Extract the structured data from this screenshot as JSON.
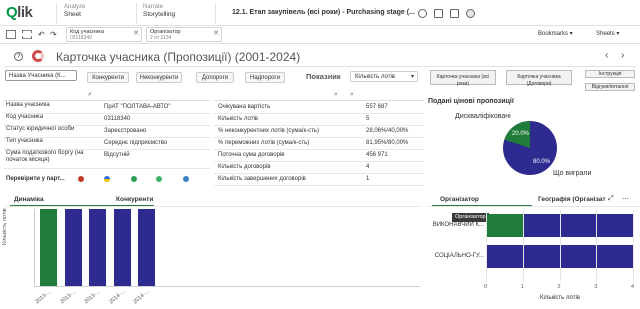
{
  "topbar": {
    "logo_prefix": "Q",
    "logo_suffix": "lik",
    "analyze_label": "Analyze",
    "analyze_value": "Sheet",
    "narrate_label": "Narrate",
    "narrate_value": "Storytelling",
    "app_title": "12.1. Етап закупівель (всі роки) - Purchasing stage (...",
    "bookmarks": "Bookmarks",
    "sheets": "Sheets"
  },
  "filters": [
    {
      "field": "Код учасника",
      "value": "03118340"
    },
    {
      "field": "Організатор",
      "value": "2 от 1134"
    }
  ],
  "sheet": {
    "title": "Карточка учасника (Пропозиції) (2001-2024)"
  },
  "controls": {
    "participant_name_btn": "Назва Учасника (К...",
    "competitors_btn": "Конкуренти",
    "noncompetitors_btn": "Неконкуренти",
    "suppliers_btn": "Допороги",
    "overthreshold_btn": "Надпороги",
    "indicator_label": "Показник",
    "indicator_value": "Кількість лотів",
    "card_all": "Карточка учасника (всі роки)",
    "card_contracts": "Карточка учасника (Договори)",
    "instruction": "Інструкція",
    "feedback": "Відгуки/питання"
  },
  "left_table": [
    {
      "label": "Назва учасника",
      "value": "ПрАТ \"ПОЛТАВА-АВТО\""
    },
    {
      "label": "Код учасника",
      "value": "03118340"
    },
    {
      "label": "Статус юридичної особи",
      "value": "Зареєстровано"
    },
    {
      "label": "Тип учасника",
      "value": "Середнє підприємство"
    },
    {
      "label": "Сума податкового боргу (на початок місяця)",
      "value": "Відсутній"
    }
  ],
  "right_table": [
    {
      "label": "Очікувана вартість",
      "value": "557 687"
    },
    {
      "label": "Кількість лотів",
      "value": "5"
    },
    {
      "label": "% неконкурентних лотів (сума/к-сть)",
      "value": "28,06%/40,00%"
    },
    {
      "label": "% переможних лотів (сума/к-сть)",
      "value": "81,95%/80,00%"
    },
    {
      "label": "Поточна сума договорів",
      "value": "456 971"
    },
    {
      "label": "Кількість договорів",
      "value": "4"
    },
    {
      "label": "Кількість завершених договорів",
      "value": "1"
    }
  ],
  "check_label": "Перевірити у парт...",
  "pie": {
    "title": "Подані цінові пропозиції",
    "label_top": "Дискваліфіковані",
    "label_bottom": "Що виграли",
    "pct_green": "20.0%",
    "pct_blue": "80.0%"
  },
  "bar_tabs": {
    "tab1": "Динаміка",
    "tab2": "Конкуренти",
    "ylabel": "Кількість лотів"
  },
  "right_chart": {
    "tab1": "Організатор",
    "tab2": "Географія (Організат",
    "tooltip": "Організатор",
    "cat1": "ВИКОНАВЧИЙ К...",
    "cat2": "СОЦІАЛЬНО-ГУ...",
    "xlabel": "Кількість лотів",
    "ticks": [
      "0",
      "1",
      "2",
      "3",
      "4"
    ]
  },
  "chart_data": [
    {
      "type": "bar",
      "categories": [
        "2013-...",
        "2013-...",
        "2013-...",
        "2014-...",
        "2014-..."
      ],
      "ylabel": "Кількість лотів",
      "values": [
        1,
        1,
        1,
        1,
        1
      ]
    },
    {
      "type": "bar",
      "categories": [
        "ВИКОНАВЧИЙ К...",
        "СОЦІАЛЬНО-ГУ..."
      ],
      "values": [
        4,
        4
      ],
      "xlabel": "Кількість лотів",
      "xlim": [
        0,
        4
      ]
    }
  ],
  "colors": {
    "green": "#1f7c3a",
    "blue": "#2d2b8f",
    "accent": "#009845"
  }
}
